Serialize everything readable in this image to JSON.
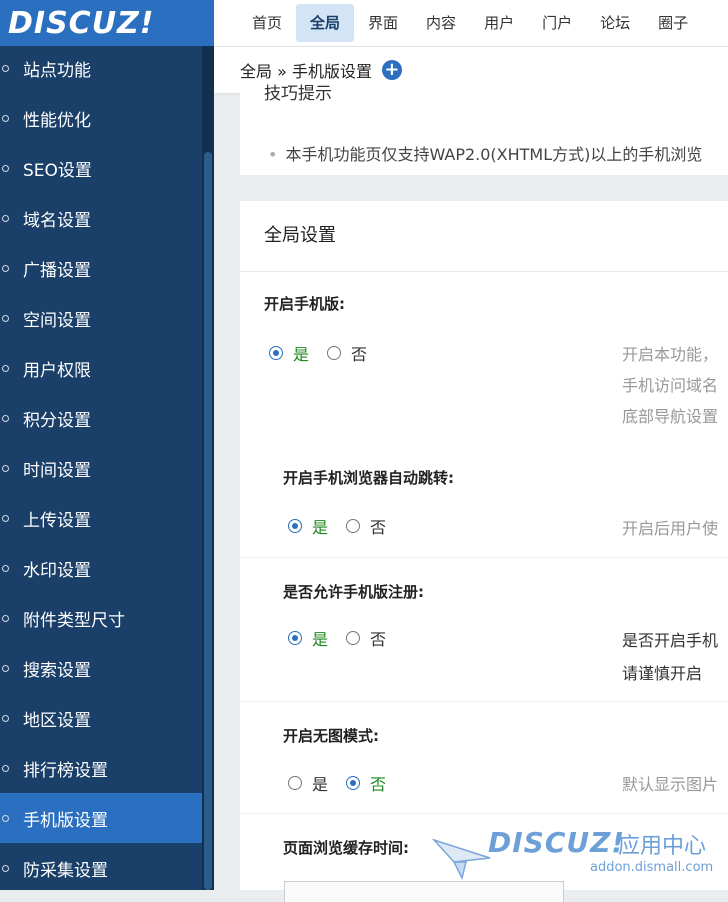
{
  "logo": "DISCUZ!",
  "top_nav": [
    "首页",
    "全局",
    "界面",
    "内容",
    "用户",
    "门户",
    "论坛",
    "圈子"
  ],
  "top_nav_active": 1,
  "breadcrumb": "全局 » 手机版设置",
  "sidebar": {
    "items": [
      {
        "label": "站点功能"
      },
      {
        "label": "性能优化"
      },
      {
        "label": "SEO设置"
      },
      {
        "label": "域名设置"
      },
      {
        "label": "广播设置"
      },
      {
        "label": "空间设置"
      },
      {
        "label": "用户权限"
      },
      {
        "label": "积分设置"
      },
      {
        "label": "时间设置"
      },
      {
        "label": "上传设置"
      },
      {
        "label": "水印设置"
      },
      {
        "label": "附件类型尺寸"
      },
      {
        "label": "搜索设置"
      },
      {
        "label": "地区设置"
      },
      {
        "label": "排行榜设置"
      },
      {
        "label": "手机版设置"
      },
      {
        "label": "防采集设置"
      }
    ],
    "active_index": 15
  },
  "tips": {
    "heading": "技巧提示",
    "line": "本手机功能页仅支持WAP2.0(XHTML方式)以上的手机浏览"
  },
  "section_title": "全局设置",
  "settings": [
    {
      "label": "开启手机版:",
      "yes": "是",
      "no": "否",
      "selected": "yes",
      "desc": [
        "开启本功能，",
        "手机访问域名",
        "底部导航设置"
      ]
    },
    {
      "label": "开启手机浏览器自动跳转:",
      "yes": "是",
      "no": "否",
      "selected": "yes",
      "desc": [
        "开启后用户使"
      ]
    },
    {
      "label": "是否允许手机版注册:",
      "yes": "是",
      "no": "否",
      "selected": "yes",
      "desc": [
        "是否开启手机",
        "请谨慎开启"
      ]
    },
    {
      "label": "开启无图模式:",
      "yes": "是",
      "no": "否",
      "selected": "no",
      "desc": [
        "默认显示图片"
      ]
    },
    {
      "label": "页面浏览缓存时间:"
    }
  ],
  "watermark": {
    "brand": "DISCUZ!",
    "cn": "应用中心",
    "url": "addon.dismall.com"
  }
}
